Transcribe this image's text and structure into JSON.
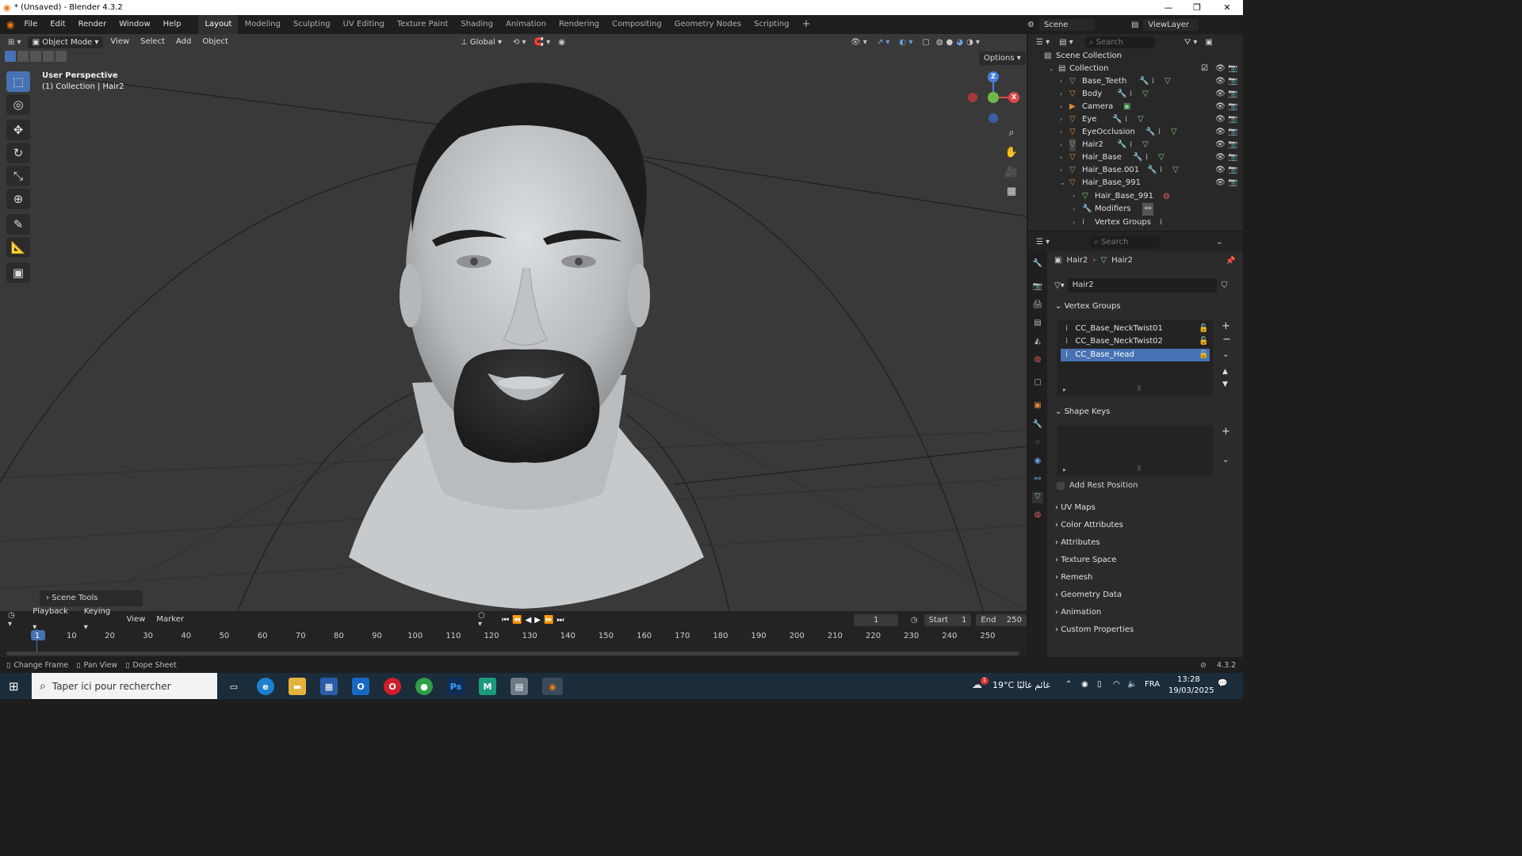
{
  "window": {
    "title": "* (Unsaved) - Blender 4.3.2",
    "minimize": "—",
    "restore": "❐",
    "close": "✕"
  },
  "menu": [
    "File",
    "Edit",
    "Render",
    "Window",
    "Help"
  ],
  "workspaces": [
    "Layout",
    "Modeling",
    "Sculpting",
    "UV Editing",
    "Texture Paint",
    "Shading",
    "Animation",
    "Rendering",
    "Compositing",
    "Geometry Nodes",
    "Scripting"
  ],
  "active_workspace": "Layout",
  "scene": {
    "label": "Scene",
    "viewlayer": "ViewLayer"
  },
  "viewport_header": {
    "mode": "Object Mode",
    "menus": [
      "View",
      "Select",
      "Add",
      "Object"
    ],
    "orientation": "Global",
    "options": "Options"
  },
  "viewport": {
    "perspective": "User Perspective",
    "collection_info": "(1) Collection | Hair2",
    "scene_tools": "Scene Tools",
    "axes": {
      "x": "X",
      "y": "Y",
      "z": "Z"
    }
  },
  "outliner": {
    "search_placeholder": "Search",
    "root": "Scene Collection",
    "collection": "Collection",
    "items": [
      {
        "name": "Base_Teeth"
      },
      {
        "name": "Body"
      },
      {
        "name": "Camera"
      },
      {
        "name": "Eye"
      },
      {
        "name": "EyeOcclusion"
      },
      {
        "name": "Hair2"
      },
      {
        "name": "Hair_Base"
      },
      {
        "name": "Hair_Base.001"
      },
      {
        "name": "Hair_Base_991"
      }
    ],
    "children": [
      "Hair_Base_991",
      "Modifiers",
      "Vertex Groups"
    ]
  },
  "properties": {
    "search_placeholder": "Search",
    "breadcrumb": [
      "Hair2",
      "Hair2"
    ],
    "data_name": "Hair2",
    "vertex_groups_label": "Vertex Groups",
    "vertex_groups": [
      "CC_Base_NeckTwist01",
      "CC_Base_NeckTwist02",
      "CC_Base_Head"
    ],
    "selected_group": "CC_Base_Head",
    "shape_keys_label": "Shape Keys",
    "add_rest_position": "Add Rest Position",
    "sections": [
      "UV Maps",
      "Color Attributes",
      "Attributes",
      "Texture Space",
      "Remesh",
      "Geometry Data",
      "Animation",
      "Custom Properties"
    ]
  },
  "timeline": {
    "menus": [
      "Playback",
      "Keying",
      "View",
      "Marker"
    ],
    "current_frame": "1",
    "start_label": "Start",
    "start": "1",
    "end_label": "End",
    "end": "250",
    "ticks": [
      "1",
      "10",
      "20",
      "30",
      "40",
      "50",
      "60",
      "70",
      "80",
      "90",
      "100",
      "110",
      "120",
      "130",
      "140",
      "150",
      "160",
      "170",
      "180",
      "190",
      "200",
      "210",
      "220",
      "230",
      "240",
      "250"
    ]
  },
  "statusbar": {
    "items": [
      "Change Frame",
      "Pan View",
      "Dope Sheet"
    ],
    "version": "4.3.2"
  },
  "taskbar": {
    "search_placeholder": "Taper ici pour rechercher",
    "weather": "19°C  غائم غالبًا",
    "lang": "FRA",
    "time": "13:28",
    "date": "19/03/2025",
    "weather_badge": "1"
  },
  "colors": {
    "accent": "#4772b3",
    "viewport_bg": "#393939",
    "orange": "#e0873a",
    "green": "#7fcf7f"
  }
}
